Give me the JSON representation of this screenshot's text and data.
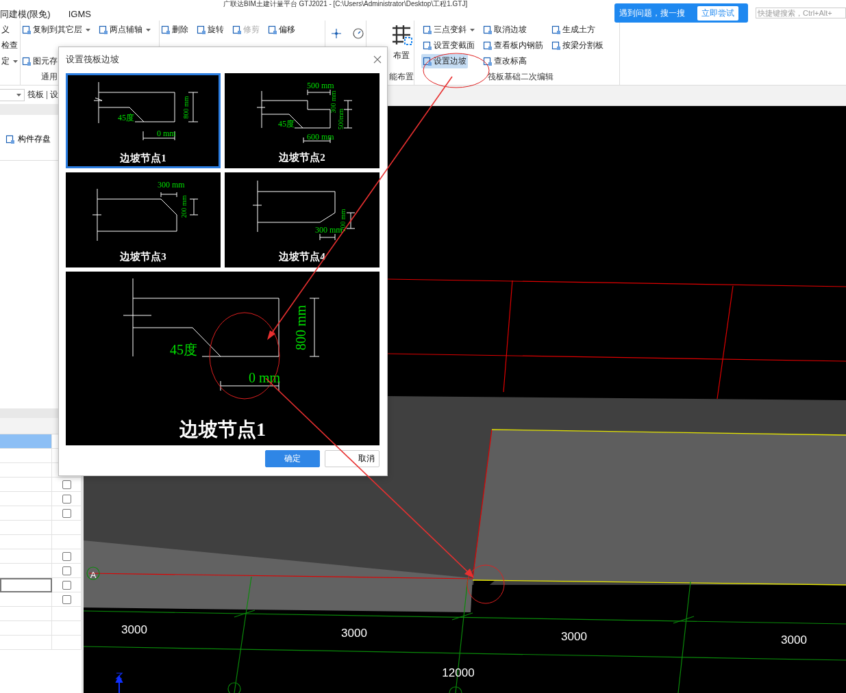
{
  "window": {
    "title": "广联达BIM土建计量平台 GTJ2021 - [C:\\Users\\Administrator\\Desktop\\工程1.GTJ]"
  },
  "menu": [
    {
      "label": "同建模(限免)"
    },
    {
      "label": "IGMS"
    }
  ],
  "help_tip": {
    "text": "遇到问题，搜一搜",
    "button": "立即尝试"
  },
  "search": {
    "placeholder": "快捷键搜索，Ctrl+Alt+"
  },
  "ribbon": {
    "groups": [
      {
        "kind": "small",
        "items": [
          {
            "label": "义",
            "selected": false,
            "disabled": false,
            "dropdown": false
          },
          {
            "label": "检查",
            "selected": false,
            "disabled": false,
            "dropdown": false
          },
          {
            "label": "定",
            "selected": false,
            "disabled": false,
            "dropdown": true
          }
        ]
      },
      {
        "kind": "small",
        "label": "通用",
        "items": [
          {
            "label": "复制到其它层",
            "selected": false,
            "disabled": false,
            "dropdown": true
          },
          {
            "label": "图元存",
            "selected": false,
            "disabled": false,
            "dropdown": false
          },
          {
            "label": "两点辅轴",
            "selected": false,
            "disabled": false,
            "dropdown": true
          }
        ]
      },
      {
        "kind": "small",
        "items": [
          {
            "label": "删除",
            "selected": false,
            "disabled": false,
            "dropdown": false
          },
          {
            "label": "旋转",
            "selected": false,
            "disabled": false,
            "dropdown": false
          },
          {
            "label": "修剪",
            "selected": false,
            "disabled": true,
            "dropdown": false
          },
          {
            "label": "偏移",
            "selected": false,
            "disabled": false,
            "dropdown": false
          }
        ]
      },
      {
        "kind": "big",
        "label": "能布置",
        "items": [
          {
            "label": "布置",
            "selected": false,
            "disabled": false,
            "dropdown": false
          }
        ]
      },
      {
        "kind": "small",
        "label": "筏板基础二次编辑",
        "items": [
          {
            "label": "三点变斜",
            "selected": false,
            "disabled": false,
            "dropdown": true
          },
          {
            "label": "设置变截面",
            "selected": false,
            "disabled": false,
            "dropdown": false
          },
          {
            "label": "设置边坡",
            "selected": true,
            "disabled": false,
            "dropdown": false
          },
          {
            "label": "取消边坡",
            "selected": false,
            "disabled": false,
            "dropdown": false
          },
          {
            "label": "查看板内钢筋",
            "selected": false,
            "disabled": false,
            "dropdown": false
          },
          {
            "label": "查改标高",
            "selected": false,
            "disabled": false,
            "dropdown": false
          },
          {
            "label": "生成土方",
            "selected": false,
            "disabled": false,
            "dropdown": false
          },
          {
            "label": "按梁分割板",
            "selected": false,
            "disabled": false,
            "dropdown": false
          }
        ]
      }
    ]
  },
  "left_panel": {
    "filter": "筏板",
    "filter_2": "设",
    "save_button": "构件存盘",
    "rows": [
      {
        "kind": "plain",
        "selected": true
      },
      {
        "kind": "plain",
        "selected": false
      },
      {
        "kind": "plain",
        "selected": false
      },
      {
        "kind": "checkbox",
        "selected": false,
        "checked": false
      },
      {
        "kind": "checkbox",
        "selected": false,
        "checked": false
      },
      {
        "kind": "checkbox",
        "selected": false,
        "checked": false
      },
      {
        "kind": "plain",
        "selected": false
      },
      {
        "kind": "plain",
        "selected": false
      },
      {
        "kind": "checkbox",
        "selected": false,
        "checked": false
      },
      {
        "kind": "checkbox",
        "selected": false,
        "checked": false
      },
      {
        "kind": "edit",
        "selected": false,
        "checked": false
      },
      {
        "kind": "checkbox",
        "selected": false,
        "checked": false
      },
      {
        "kind": "plain",
        "selected": false
      },
      {
        "kind": "plain",
        "selected": false
      },
      {
        "kind": "plain",
        "selected": false
      }
    ]
  },
  "dialog": {
    "title": "设置筏板边坡",
    "thumbnails": [
      {
        "caption": "边坡节点1",
        "selected": true,
        "labels": [
          "45度",
          "800 mm",
          "0 mm"
        ]
      },
      {
        "caption": "边坡节点2",
        "selected": false,
        "labels": [
          "500 mm",
          "300 mm",
          "500mm",
          "45度",
          "600 mm"
        ]
      },
      {
        "caption": "边坡节点3",
        "selected": false,
        "labels": [
          "300 mm",
          "200 mm"
        ]
      },
      {
        "caption": "边坡节点4",
        "selected": false,
        "labels": [
          "200 mm",
          "300 mm"
        ]
      }
    ],
    "preview": {
      "caption": "边坡节点1",
      "labels": [
        "45度",
        "800 mm",
        "0 mm"
      ]
    },
    "buttons": [
      {
        "label": "确定",
        "kind": "primary"
      },
      {
        "label": "取消",
        "kind": "secondary"
      }
    ]
  },
  "canvas": {
    "axis_label": "A",
    "spans": [
      "3000",
      "3000",
      "3000",
      "3000"
    ],
    "total": "12000"
  }
}
